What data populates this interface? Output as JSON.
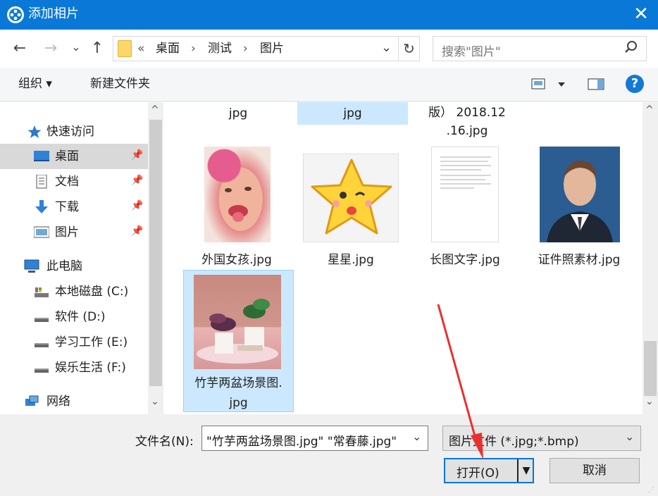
{
  "window": {
    "title": "添加相片",
    "close_glyph": "✕"
  },
  "nav": {
    "back_glyph": "←",
    "forward_glyph": "→",
    "recent_glyph": "⌄",
    "up_glyph": "↑",
    "address": {
      "chevrons": "«",
      "crumbs": [
        "桌面",
        "测试",
        "图片"
      ],
      "sep": "›",
      "dropdown_glyph": "⌄",
      "refresh_glyph": "↻"
    },
    "search": {
      "placeholder": "搜索\"图片\"",
      "icon": "search-icon"
    }
  },
  "toolbar": {
    "organize": "组织 ▾",
    "new_folder": "新建文件夹",
    "help": "?"
  },
  "sidebar": {
    "quick_access": "快速访问",
    "items": [
      {
        "label": "桌面",
        "icon": "desktop-icon",
        "pinned": true
      },
      {
        "label": "文档",
        "icon": "document-icon",
        "pinned": true
      },
      {
        "label": "下载",
        "icon": "download-icon",
        "pinned": true
      },
      {
        "label": "图片",
        "icon": "pictures-icon",
        "pinned": true
      }
    ],
    "this_pc": "此电脑",
    "drives": [
      {
        "label": "本地磁盘 (C:)",
        "icon": "drive-icon"
      },
      {
        "label": "软件 (D:)",
        "icon": "drive-icon"
      },
      {
        "label": "学习工作 (E:)",
        "icon": "drive-icon"
      },
      {
        "label": "娱乐生活 (F:)",
        "icon": "drive-icon"
      }
    ],
    "network": "网络",
    "scroll_up": "^",
    "scroll_down": "⌄"
  },
  "content": {
    "top_row": [
      {
        "name": "jpg",
        "selected": false
      },
      {
        "name": "jpg",
        "selected": true
      },
      {
        "name": "版） 2018.12\n.16.jpg",
        "selected": false
      }
    ],
    "files": [
      {
        "name": "外国女孩.jpg",
        "selected": false
      },
      {
        "name": "星星.jpg",
        "selected": false
      },
      {
        "name": "长图文字.jpg",
        "selected": false
      },
      {
        "name": "证件照素材.jpg",
        "selected": false
      },
      {
        "name": "竹芋两盆场景图.\njpg",
        "selected": true
      }
    ],
    "scroll_up": "^",
    "scroll_down": "⌄"
  },
  "footer": {
    "filename_label": "文件名(N):",
    "filename_value": "\"竹芋两盆场景图.jpg\" \"常春藤.jpg\"",
    "filetype_value": "图片文件 (*.jpg;*.bmp)",
    "dropdown_glyph": "⌄",
    "open_label": "打开(O)",
    "open_split_glyph": "▼",
    "cancel_label": "取消"
  },
  "colors": {
    "titlebar": "#0a78d7",
    "selection": "#cce8ff",
    "annotation_arrow": "#e8312f"
  }
}
